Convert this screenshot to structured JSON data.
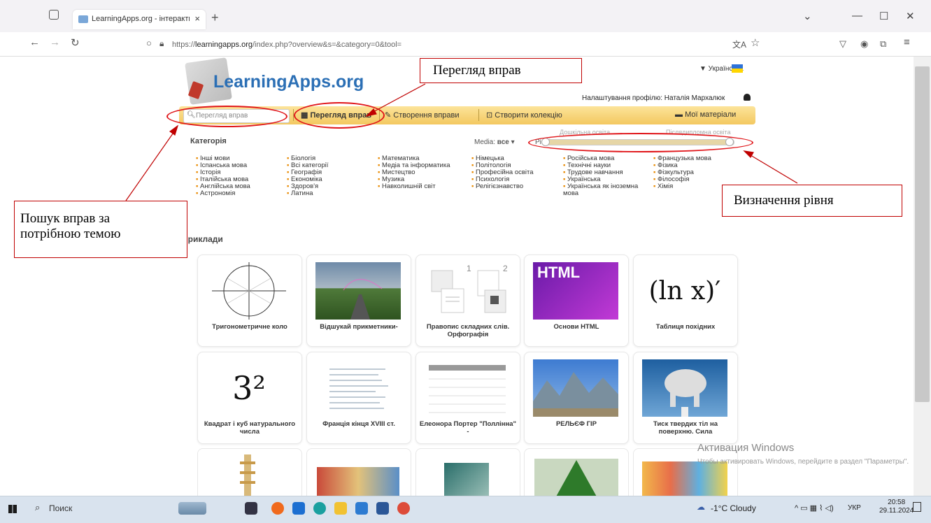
{
  "browser": {
    "tab_title": "LearningApps.org - інтерактив",
    "tab_close": "×",
    "new_tab": "+",
    "url_prefix": "https://",
    "url_domain": "learningapps.org",
    "url_path": "/index.php?overview&s=&category=0&tool=",
    "minimize": "—",
    "maximize": "☐",
    "close": "✕",
    "tab_list": "⌄"
  },
  "site": {
    "logo": "LearningApps.org",
    "language": "▼ Українська",
    "profile_label": "Налаштування профілю: Наталія Мархалюк"
  },
  "menu": {
    "search_placeholder": "Перегляд вправ",
    "browse": "Перегляд вправ",
    "create": "Створення вправи",
    "collection": "Створити колекцію",
    "my": "Мої матеріали"
  },
  "filters": {
    "category_title": "Категорія",
    "media_label": "Media:",
    "media_value": "все",
    "level_label": "Рівні:",
    "level_low": "Дошкільна освіта",
    "level_high": "Післядипломна освіта"
  },
  "categories": {
    "col1": [
      "Інші мови",
      "Іспанська мова",
      "Історія",
      "Італійська мова",
      "Англійська мова",
      "Астрономія"
    ],
    "col2": [
      "Біологія",
      "Всі категорії",
      "Географія",
      "Економіка",
      "Здоров'я",
      "Латина"
    ],
    "col3": [
      "Математика",
      "Медіа та інформатика",
      "Мистецтво",
      "Музика",
      "Навколишній світ"
    ],
    "col4": [
      "Німецька",
      "Політологія",
      "Професійна освіта",
      "Психологія",
      "Релігієзнавство"
    ],
    "col5": [
      "Російська мова",
      "Технічні науки",
      "Трудове навчання",
      "Українська",
      "Українська як іноземна мова"
    ],
    "col6": [
      "Французька мова",
      "Фізика",
      "Фізкультура",
      "Філософія",
      "Хімія"
    ]
  },
  "examples": {
    "title": "Приклади",
    "row1": [
      "Тригонометричне коло",
      "Відшукай прикметники-",
      "Правопис складних слів. Орфографія",
      "Основи HTML",
      "Таблиця похідних"
    ],
    "row2": [
      "Квадрат і куб натурального числа",
      "Франція кінця XVIII ст.",
      "Елеонора Портер \"Поллінна\" -",
      "РЕЛЬЄФ ГІР",
      "Тиск твердих тіл на поверхню. Сила"
    ],
    "thumb_html": "HTML",
    "thumb_ln": "(ln x)′",
    "thumb_power": "3²",
    "thumb_num1": "1",
    "thumb_num2": "2"
  },
  "annotations": {
    "browse": "Перегляд вправ",
    "level": "Визначення рівня",
    "search_line1": "Пошук вправ за",
    "search_line2": "потрібною темою"
  },
  "watermark": {
    "title": "Активация Windows",
    "subtitle": "Чтобы активировать Windows, перейдите в раздел \"Параметры\"."
  },
  "taskbar": {
    "search": "Поиск",
    "weather": "-1°C Cloudy",
    "lang": "УКР",
    "time": "20:58",
    "date": "29.11.2024"
  },
  "colors": {
    "accent_blue": "#2b6fb5",
    "menu_yellow": "#f3c860",
    "annotation_red": "#e0161a"
  }
}
